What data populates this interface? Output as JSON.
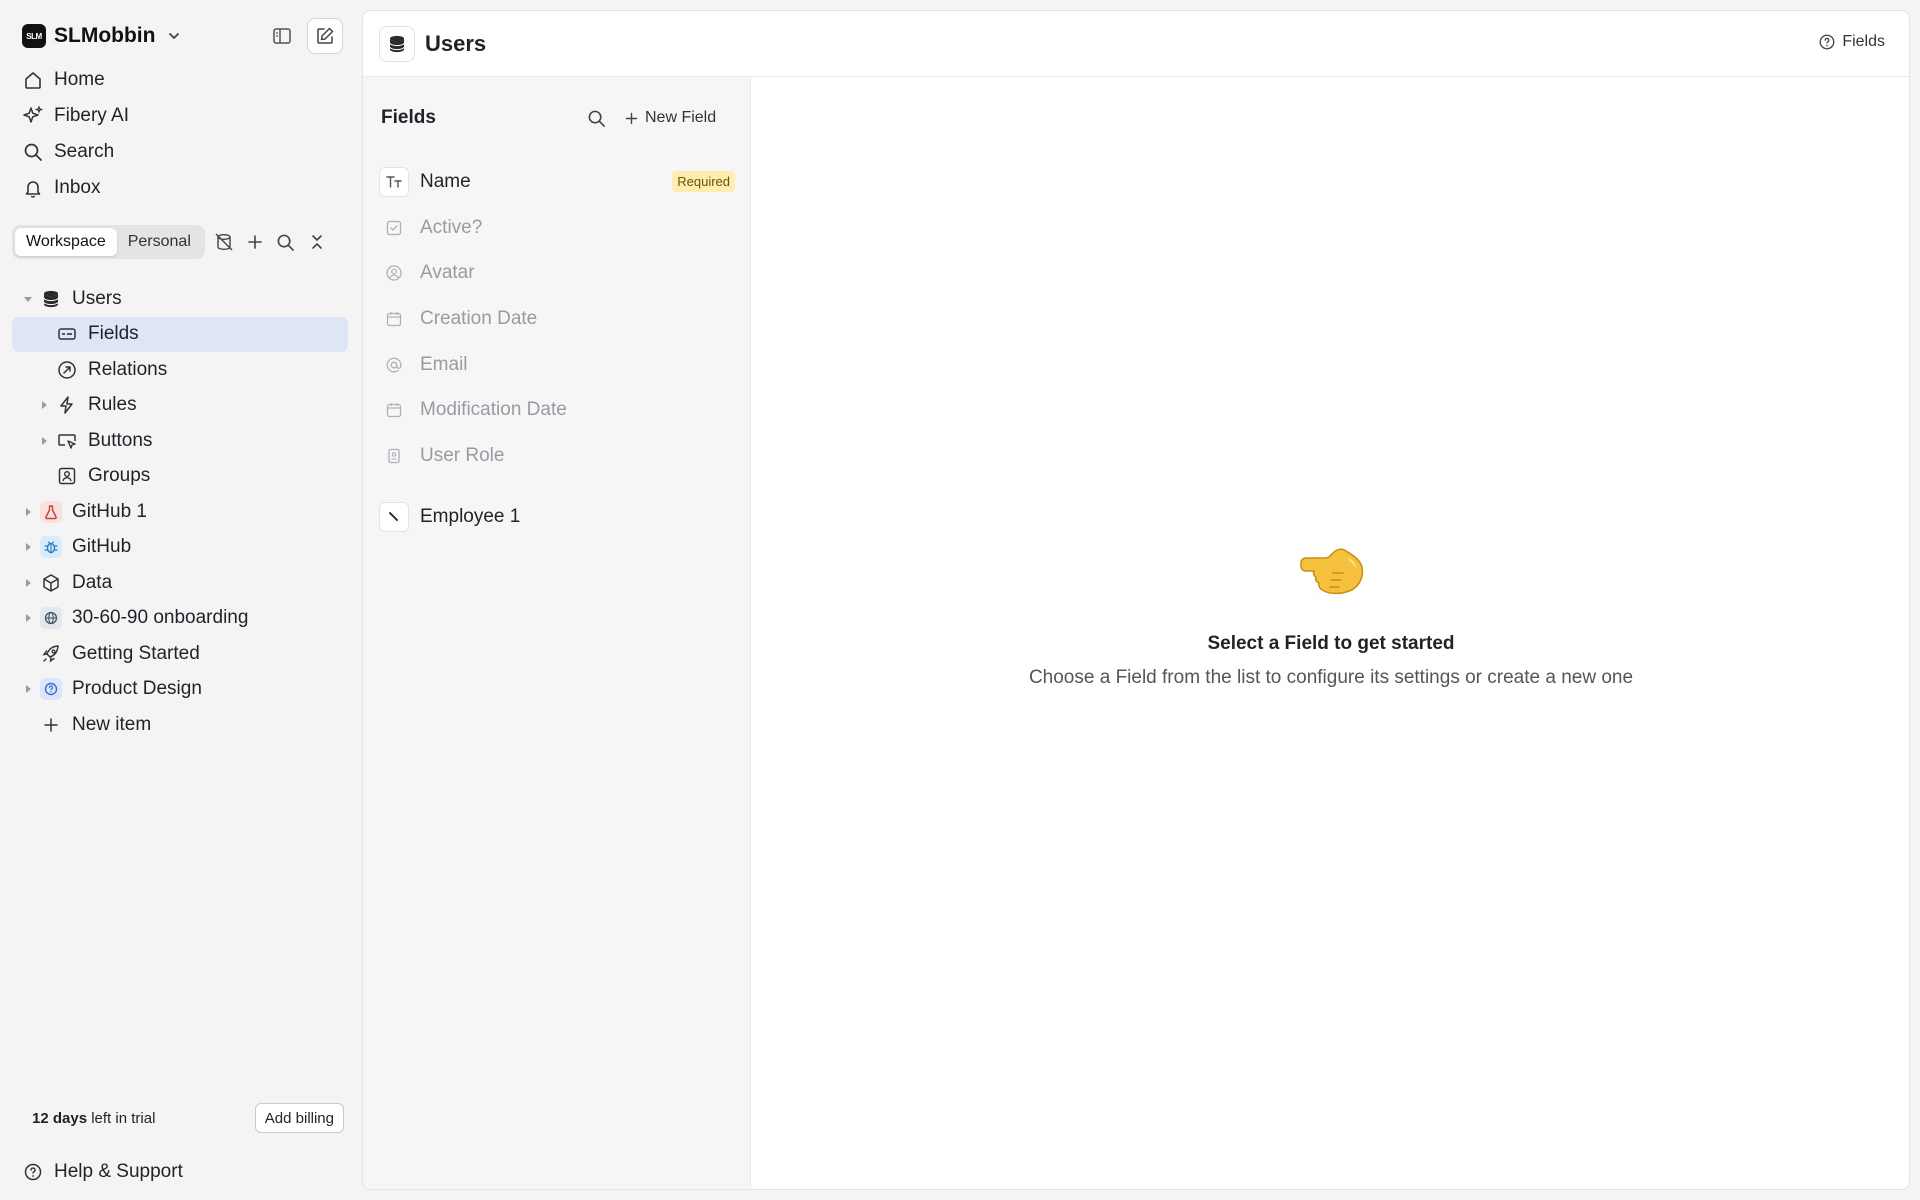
{
  "workspace": {
    "logo_text": "SLM",
    "name": "SLMobbin"
  },
  "nav": [
    {
      "label": "Home",
      "icon": "home-icon"
    },
    {
      "label": "Fibery AI",
      "icon": "sparkle-icon"
    },
    {
      "label": "Search",
      "icon": "search-icon"
    },
    {
      "label": "Inbox",
      "icon": "bell-icon"
    }
  ],
  "scope": {
    "workspace": "Workspace",
    "personal": "Personal",
    "active": "Workspace"
  },
  "tree": {
    "users": "Users",
    "fields": "Fields",
    "relations": "Relations",
    "rules": "Rules",
    "buttons": "Buttons",
    "groups": "Groups",
    "github1": "GitHub 1",
    "github": "GitHub",
    "data": "Data",
    "onboarding": "30-60-90 onboarding",
    "getting_started": "Getting Started",
    "product_design": "Product Design",
    "new_item": "New item"
  },
  "trial": {
    "days": "12 days",
    "rest": " left in trial",
    "button": "Add billing"
  },
  "help": "Help & Support",
  "header": {
    "title": "Users",
    "help_link": "Fields"
  },
  "fields_panel": {
    "title": "Fields",
    "new_field": "New Field",
    "fields": [
      {
        "label": "Name",
        "badge": "Required"
      },
      {
        "label": "Active?"
      },
      {
        "label": "Avatar"
      },
      {
        "label": "Creation Date"
      },
      {
        "label": "Email"
      },
      {
        "label": "Modification Date"
      },
      {
        "label": "User Role"
      },
      {
        "label": "Employee 1"
      }
    ]
  },
  "empty_state": {
    "emoji": "👈",
    "title": "Select a Field to get started",
    "subtitle": "Choose a Field from the list to configure its settings or create a new one"
  },
  "colors": {
    "selected_bg": "#dde5f6",
    "required_bg": "#fdeeb0",
    "accent": "#4a77d6"
  }
}
